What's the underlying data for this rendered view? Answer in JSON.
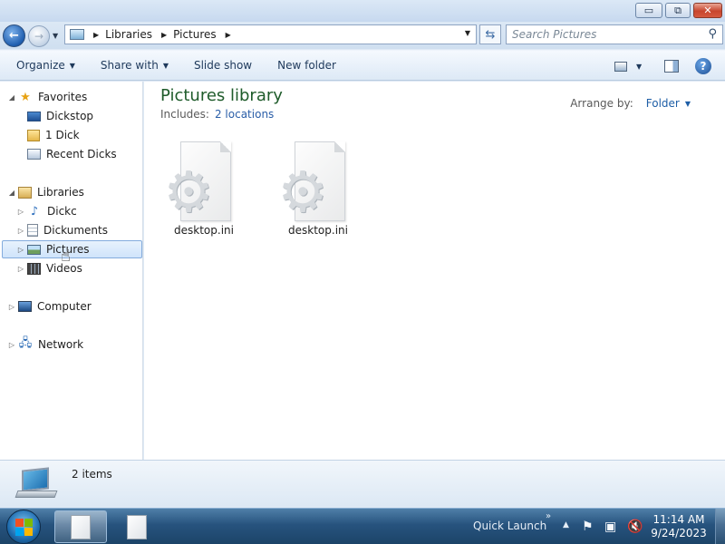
{
  "window": {
    "controls": {
      "minimize": "▭",
      "maximize": "⧉",
      "close": "✕"
    }
  },
  "nav": {
    "back_icon": "back-arrow-icon",
    "forward_icon": "forward-arrow-icon"
  },
  "address_bar": {
    "breadcrumbs": [
      "Libraries",
      "Pictures"
    ],
    "dropdown_icon": "chevron-down-icon"
  },
  "search": {
    "placeholder": "Search Pictures"
  },
  "toolbar": {
    "organize": "Organize",
    "share_with": "Share with",
    "slide_show": "Slide show",
    "new_folder": "New folder",
    "help": "?"
  },
  "sidebar": {
    "items": [
      {
        "label": "Favorites",
        "icon": "star-icon"
      },
      {
        "label": "Dickstop",
        "icon": "desktop-icon"
      },
      {
        "label": "1 Dick",
        "icon": "folder-icon"
      },
      {
        "label": "Recent Dicks",
        "icon": "recent-places-icon"
      },
      {
        "label": "Libraries",
        "icon": "library-icon"
      },
      {
        "label": "Dickc",
        "icon": "music-icon"
      },
      {
        "label": "Dickuments",
        "icon": "documents-icon"
      },
      {
        "label": "Pictures",
        "icon": "pictures-icon",
        "selected": true
      },
      {
        "label": "Videos",
        "icon": "videos-icon"
      },
      {
        "label": "Computer",
        "icon": "computer-icon"
      },
      {
        "label": "Network",
        "icon": "network-icon"
      }
    ]
  },
  "library": {
    "title": "Pictures library",
    "includes_label": "Includes:",
    "includes_link": "2 locations",
    "arrange_label": "Arrange by:",
    "arrange_value": "Folder"
  },
  "files": [
    {
      "name": "desktop.ini",
      "icon": "settings-file-icon"
    },
    {
      "name": "desktop.ini",
      "icon": "settings-file-icon"
    }
  ],
  "details": {
    "count": "2 items"
  },
  "taskbar": {
    "quick_launch": "Quick Launch",
    "chevron": "»",
    "clock_time": "11:14 AM",
    "clock_date": "9/24/2023",
    "start_colors": [
      "#f25022",
      "#7fba00",
      "#00a4ef",
      "#ffb900"
    ]
  }
}
